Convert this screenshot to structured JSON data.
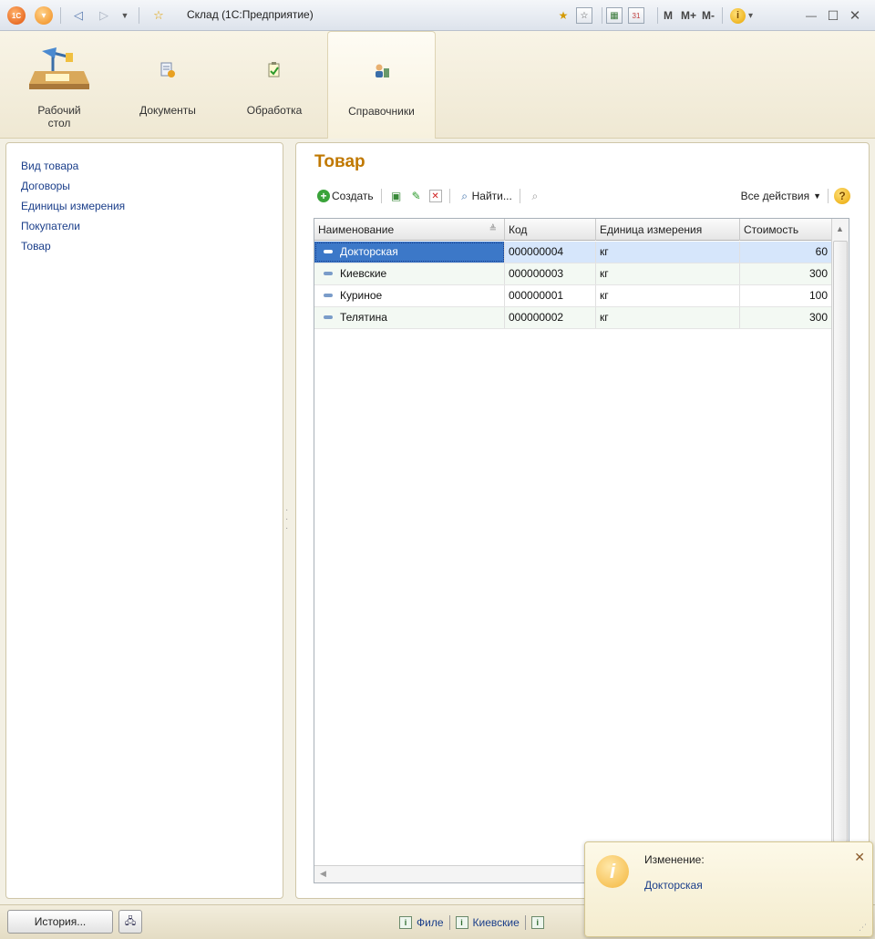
{
  "window": {
    "title": "Склад  (1С:Предприятие)",
    "memory": {
      "m": "M",
      "m_plus": "M+",
      "m_minus": "M-"
    }
  },
  "sections": [
    {
      "label_line1": "Рабочий",
      "label_line2": "стол",
      "icon": "desktop-lamp-icon"
    },
    {
      "label_line1": "Документы",
      "label_line2": "",
      "icon": "documents-icon"
    },
    {
      "label_line1": "Обработка",
      "label_line2": "",
      "icon": "processing-icon"
    },
    {
      "label_line1": "Справочники",
      "label_line2": "",
      "icon": "catalogs-icon"
    }
  ],
  "active_section": "Справочники",
  "nav": {
    "items": [
      {
        "label": "Вид товара"
      },
      {
        "label": "Договоры"
      },
      {
        "label": "Единицы измерения"
      },
      {
        "label": "Покупатели"
      },
      {
        "label": "Товар"
      }
    ]
  },
  "form": {
    "title": "Товар",
    "toolbar": {
      "create": "Создать",
      "find": "Найти...",
      "all_actions": "Все действия",
      "help": "?"
    },
    "columns": [
      "Наименование",
      "Код",
      "Единица измерения",
      "Стоимость"
    ],
    "rows": [
      {
        "name": "Докторская",
        "code": "000000004",
        "unit": "кг",
        "price": "60",
        "selected": true
      },
      {
        "name": "Киевские",
        "code": "000000003",
        "unit": "кг",
        "price": "300"
      },
      {
        "name": "Куриное",
        "code": "000000001",
        "unit": "кг",
        "price": "100"
      },
      {
        "name": "Телятина",
        "code": "000000002",
        "unit": "кг",
        "price": "300"
      }
    ]
  },
  "statusbar": {
    "history_button": "История...",
    "tasks": [
      "Филе",
      "Киевские"
    ]
  },
  "notification": {
    "title": "Изменение:",
    "link": "Докторская",
    "close": "✕"
  },
  "colors": {
    "accent_title": "#c07800",
    "link": "#1a3e8a",
    "selection": "#3c78c8"
  }
}
